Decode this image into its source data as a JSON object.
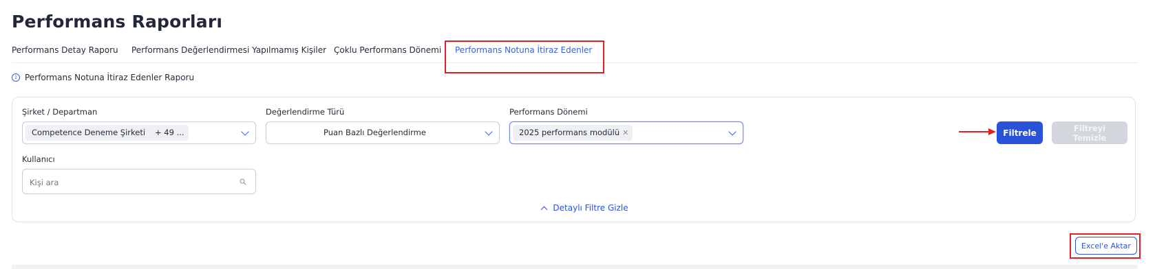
{
  "page_title": "Performans Raporları",
  "tabs": [
    {
      "label": "Performans Detay Raporu"
    },
    {
      "label": "Performans Değerlendirmesi Yapılmamış Kişiler"
    },
    {
      "label": "Çoklu Performans Dönemi"
    },
    {
      "label": "Performans Notuna İtiraz Edenler"
    }
  ],
  "active_tab_index": 3,
  "info_text": "Performans Notuna İtiraz Edenler Raporu",
  "filters": {
    "company": {
      "label": "Şirket / Departman",
      "chips": [
        "Competence Deneme Şirketi"
      ],
      "more": "+ 49 ..."
    },
    "evaluation_type": {
      "label": "Değerlendirme Türü",
      "value": "Puan Bazlı Değerlendirme"
    },
    "period": {
      "label": "Performans Dönemi",
      "chips": [
        "2025 performans modülü"
      ]
    },
    "user": {
      "label": "Kullanıcı",
      "placeholder": "Kişi ara"
    }
  },
  "buttons": {
    "filter": "Filtrele",
    "clear": "Filtreyi Temizle",
    "export": "Excel'e Aktar"
  },
  "toggle_label": "Detaylı Filtre Gizle",
  "colors": {
    "accent": "#2952d9",
    "highlight": "#e31e24",
    "disabled": "#d3d6dc"
  }
}
